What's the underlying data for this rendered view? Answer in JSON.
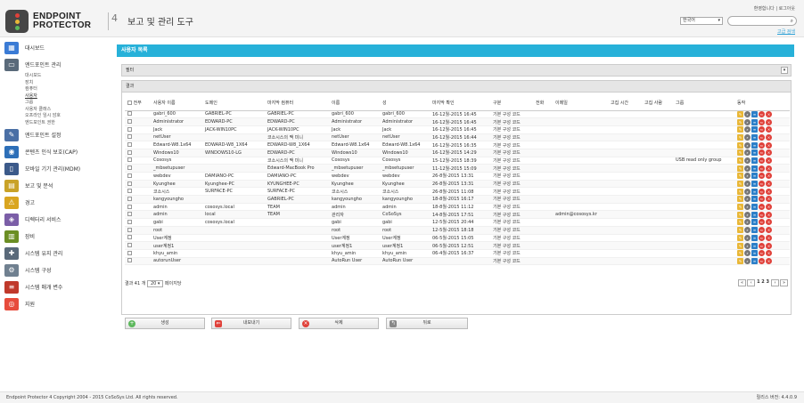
{
  "header": {
    "logo_line1": "ENDPOINT",
    "logo_line2": "PROTECTOR",
    "logo_version": "4",
    "page_title": "보고 및 관리 도구",
    "user_links": "환영합니다 | 로그아웃",
    "language": "한국어",
    "advanced_search": "고급 검색"
  },
  "sidebar": {
    "items": [
      {
        "label": "대시보드",
        "icon": "dashboard-icon",
        "color": "#3a7bd5"
      },
      {
        "label": "엔드포인트 관리",
        "icon": "monitor-icon",
        "color": "#5a6a7a"
      },
      {
        "label": "엔드포인트 설정",
        "icon": "tools-icon",
        "color": "#4a6fa5"
      },
      {
        "label": "콘텐츠 인식 보호(CAP)",
        "icon": "cap-icon",
        "color": "#2d6fb8"
      },
      {
        "label": "모바일 기기 관리(MDM)",
        "icon": "mobile-icon",
        "color": "#3c5a8a"
      },
      {
        "label": "보고 및 분석",
        "icon": "folder-icon",
        "color": "#c9a227"
      },
      {
        "label": "경고",
        "icon": "alert-icon",
        "color": "#d9a520"
      },
      {
        "label": "디렉터리 서비스",
        "icon": "directory-icon",
        "color": "#7b5ea7"
      },
      {
        "label": "장비",
        "icon": "device-icon",
        "color": "#6b8e23"
      },
      {
        "label": "시스템 유지 관리",
        "icon": "wrench-icon",
        "color": "#5a6a7a"
      },
      {
        "label": "시스템 구성",
        "icon": "gear-icon",
        "color": "#708090"
      },
      {
        "label": "시스템 매개 변수",
        "icon": "parameters-icon",
        "color": "#c0392b"
      },
      {
        "label": "지원",
        "icon": "lifebuoy-icon",
        "color": "#e74c3c"
      }
    ],
    "subitems": [
      "대시보드",
      "장치",
      "컴퓨터",
      "사용자",
      "그룹",
      "사용자 클래스",
      "오프라인 임시 암호",
      "엔드포인트 권한"
    ],
    "active_subitem": 3
  },
  "main": {
    "header": "사용자 목록",
    "filter_label": "필터",
    "result_label": "결과",
    "columns": [
      "전부",
      "사용자 이름",
      "도메인",
      "마지막 컴퓨터",
      "이름",
      "성",
      "마지막 확인",
      "구분",
      "전화",
      "이메일",
      "고집 시간",
      "고집 사람",
      "그룹",
      "동작"
    ],
    "rows": [
      [
        "gabri_600",
        "GABRIEL-PC",
        "GABRIEL-PC",
        "gabri_600",
        "gabri_600",
        "16-12월-2015 16:45",
        "기본 구성 코드",
        "",
        "",
        "",
        "",
        ""
      ],
      [
        "Administrator",
        "EDWARD-PC",
        "EDWARD-PC",
        "Administrator",
        "Administrator",
        "16-12월-2015 16:45",
        "기본 구성 코드",
        "",
        "",
        "",
        "",
        ""
      ],
      [
        "Jack",
        "JACK-WIN10PC",
        "JACK-WIN10PC",
        "Jack",
        "Jack",
        "16-12월-2015 16:45",
        "기본 구성 코드",
        "",
        "",
        "",
        "",
        ""
      ],
      [
        "netUser",
        "",
        "코소시스의 맥 미니",
        "netUser",
        "netUser",
        "16-12월-2015 16:44",
        "기본 구성 코드",
        "",
        "",
        "",
        "",
        ""
      ],
      [
        "Edward-W8.1x64",
        "EDWARD-W8_1X64",
        "EDWARD-W8_1X64",
        "Edward-W8.1x64",
        "Edward-W8.1x64",
        "16-12월-2015 16:35",
        "기본 구성 코드",
        "",
        "",
        "",
        "",
        ""
      ],
      [
        "Windows10",
        "WINDOWS10-LG",
        "EDWARD-PC",
        "Windows10",
        "Windows10",
        "16-12월-2015 14:29",
        "기본 구성 코드",
        "",
        "",
        "",
        "",
        ""
      ],
      [
        "Cososys",
        "",
        "코소시스의 맥 미니",
        "Cososys",
        "Cososys",
        "15-12월-2015 18:39",
        "기본 구성 코드",
        "",
        "",
        "",
        "",
        "USB read only group"
      ],
      [
        "_mbsetupuser",
        "",
        "Edward-MacBook Pro",
        "_mbsetupuser",
        "_mbsetupuser",
        "11-12월-2015 15:09",
        "기본 구성 코드",
        "",
        "",
        "",
        "",
        ""
      ],
      [
        "webdev",
        "DAMIANO-PC",
        "DAMIANO-PC",
        "webdev",
        "webdev",
        "26-8월-2015 13:31",
        "기본 구성 코드",
        "",
        "",
        "",
        "",
        ""
      ],
      [
        "Kyunghee",
        "Kyunghee-PC",
        "KYUNGHEE-PC",
        "Kyunghee",
        "Kyunghee",
        "26-8월-2015 13:31",
        "기본 구성 코드",
        "",
        "",
        "",
        "",
        ""
      ],
      [
        "코소시스",
        "SURFACE-PC",
        "SURFACE-PC",
        "코소시스",
        "코소시스",
        "26-8월-2015 11:08",
        "기본 구성 코드",
        "",
        "",
        "",
        "",
        ""
      ],
      [
        "kangyoungho",
        "",
        "GABRIEL-PC",
        "kangyoungho",
        "kangyoungho",
        "18-8월-2015 16:17",
        "기본 구성 코드",
        "",
        "",
        "",
        "",
        ""
      ],
      [
        "admin",
        "cososys.local",
        "TEAM",
        "admin",
        "admin",
        "18-8월-2015 11:12",
        "기본 구성 코드",
        "",
        "",
        "",
        "",
        ""
      ],
      [
        "admin",
        "local",
        "TEAM",
        "관리자",
        "CoSoSys",
        "14-8월-2015 17:51",
        "기본 구성 코드",
        "",
        "admin@cososys.kr",
        "",
        "",
        ""
      ],
      [
        "gabi",
        "cososys.local",
        "",
        "gabi",
        "gabi",
        "12-5월-2015 20:44",
        "기본 구성 코드",
        "",
        "",
        "",
        "",
        ""
      ],
      [
        "root",
        "",
        "",
        "root",
        "root",
        "12-5월-2015 18:18",
        "기본 구성 코드",
        "",
        "",
        "",
        "",
        ""
      ],
      [
        "User계정",
        "",
        "",
        "User계정",
        "User계정",
        "06-5월-2015 15:05",
        "기본 구성 코드",
        "",
        "",
        "",
        "",
        ""
      ],
      [
        "user계정1",
        "",
        "",
        "user계정1",
        "user계정1",
        "06-5월-2015 12:51",
        "기본 구성 코드",
        "",
        "",
        "",
        "",
        ""
      ],
      [
        "khyu_amin",
        "",
        "",
        "khyu_amin",
        "khyu_amin",
        "06-4월-2015 16:37",
        "기본 구성 코드",
        "",
        "",
        "",
        "",
        ""
      ],
      [
        "autorunUser",
        "",
        "",
        "AutoRun User",
        "AutoRun User",
        "",
        "기본 구성 코드",
        "",
        "",
        "",
        "",
        ""
      ]
    ],
    "pager_result": "결과 41 개",
    "per_page": "20",
    "per_page_suffix": "페이지당",
    "pager_first": "«",
    "pager_prev": "‹",
    "pager_pages": "1 2 3",
    "pager_next": "›",
    "pager_last": "»"
  },
  "buttons": {
    "add": "생성",
    "export": "내보내기",
    "delete": "삭제",
    "back": "뒤로"
  },
  "footer": {
    "copyright": "Endpoint Protector 4 Copyright 2004 - 2015 CoSoSys Ltd. All rights reserved.",
    "version": "릴리스 버전: 4.4.0.9"
  },
  "colors": {
    "accent": "#27b1d9",
    "action_yellow": "#e9b737",
    "action_blue": "#2c7fc8",
    "action_red": "#e0413a"
  }
}
